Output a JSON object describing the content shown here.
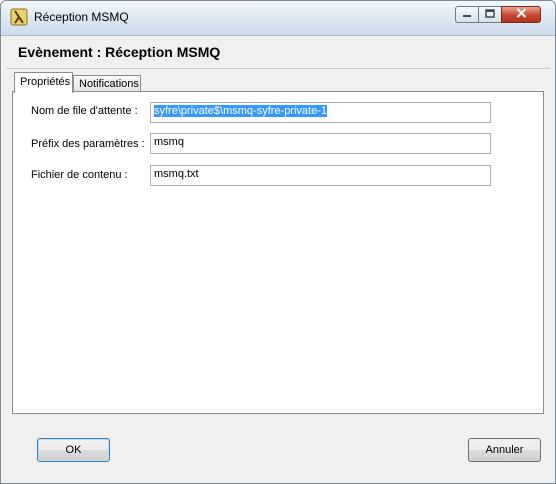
{
  "window": {
    "title": "Réception MSMQ",
    "icon": "app-lambda-icon",
    "controls": [
      "minimize-icon",
      "maximize-icon",
      "close-icon"
    ]
  },
  "header": {
    "title": "Evènement : Réception MSMQ"
  },
  "tabs": [
    {
      "label": "Propriétés",
      "active": true
    },
    {
      "label": "Notifications",
      "active": false
    }
  ],
  "form": {
    "queue_name": {
      "label": "Nom de file d'attente :",
      "value": "syfre\\private$\\msmq-syfre-private-1"
    },
    "param_prefix": {
      "label": "Préfix des paramètres :",
      "value": "msmq"
    },
    "content_file": {
      "label": "Fichier de contenu :",
      "value": "msmq.txt"
    }
  },
  "buttons": {
    "ok": "OK",
    "cancel": "Annuler"
  },
  "colors": {
    "selection": "#3399ff",
    "close_button": "#c4472e"
  }
}
